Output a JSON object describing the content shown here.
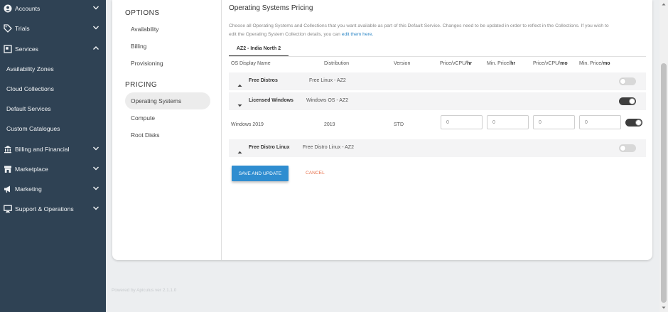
{
  "nav": {
    "accounts": "Accounts",
    "trials": "Trials",
    "services": "Services",
    "availability_zones": "Availability Zones",
    "cloud_collections": "Cloud Collections",
    "default_services": "Default Services",
    "custom_catalogues": "Custom Catalogues",
    "billing_financial": "Billing and Financial",
    "marketplace": "Marketplace",
    "marketing": "Marketing",
    "support_operations": "Support & Operations"
  },
  "subnav": {
    "options_heading": "OPTIONS",
    "availability": "Availability",
    "billing": "Billing",
    "provisioning": "Provisioning",
    "pricing_heading": "PRICING",
    "operating_systems": "Operating Systems",
    "compute": "Compute",
    "root_disks": "Root Disks"
  },
  "pane": {
    "title": "Operating Systems Pricing",
    "desc_line1": "Choose all Operating Systems and Collections that you want available as part of this Default Service. Changes need to be updated in order to reflect in the Collections. If you wish to",
    "desc_line2": "edit the Operating System Collection details, you can",
    "desc_link": "edit them here.",
    "tab": "AZ2 - India North 2"
  },
  "columns": {
    "os_name": "OS Display Name",
    "distribution": "Distribution",
    "version": "Version",
    "price_vcpu_hr_pre": "Price/vCPU/",
    "price_vcpu_hr_bold": "hr",
    "min_price_hr_pre": "Min. Price/",
    "min_price_hr_bold": "hr",
    "price_vcpu_mo_pre": "Price/vCPU/",
    "price_vcpu_mo_bold": "mo",
    "min_price_mo_pre": "Min. Price/",
    "min_price_mo_bold": "mo"
  },
  "groups": [
    {
      "name": "Free Distros",
      "collection": "Free Linux - AZ2",
      "enabled": false
    },
    {
      "name": "Licensed Windows",
      "collection": "Windows OS - AZ2",
      "enabled": true
    },
    {
      "name": "Free Distro Linux",
      "collection": "Free Distro Linux - AZ2",
      "enabled": false
    }
  ],
  "os_row": {
    "name": "Windows 2019",
    "distribution": "2019",
    "version": "STD",
    "price_vcpu_hr": "0",
    "min_price_hr": "0",
    "price_vcpu_mo": "0",
    "min_price_mo": "0",
    "enabled": true
  },
  "actions": {
    "save": "SAVE AND UPDATE",
    "cancel": "CANCEL"
  },
  "footer": "Powered by Apiculus ver 2.1.1.0"
}
